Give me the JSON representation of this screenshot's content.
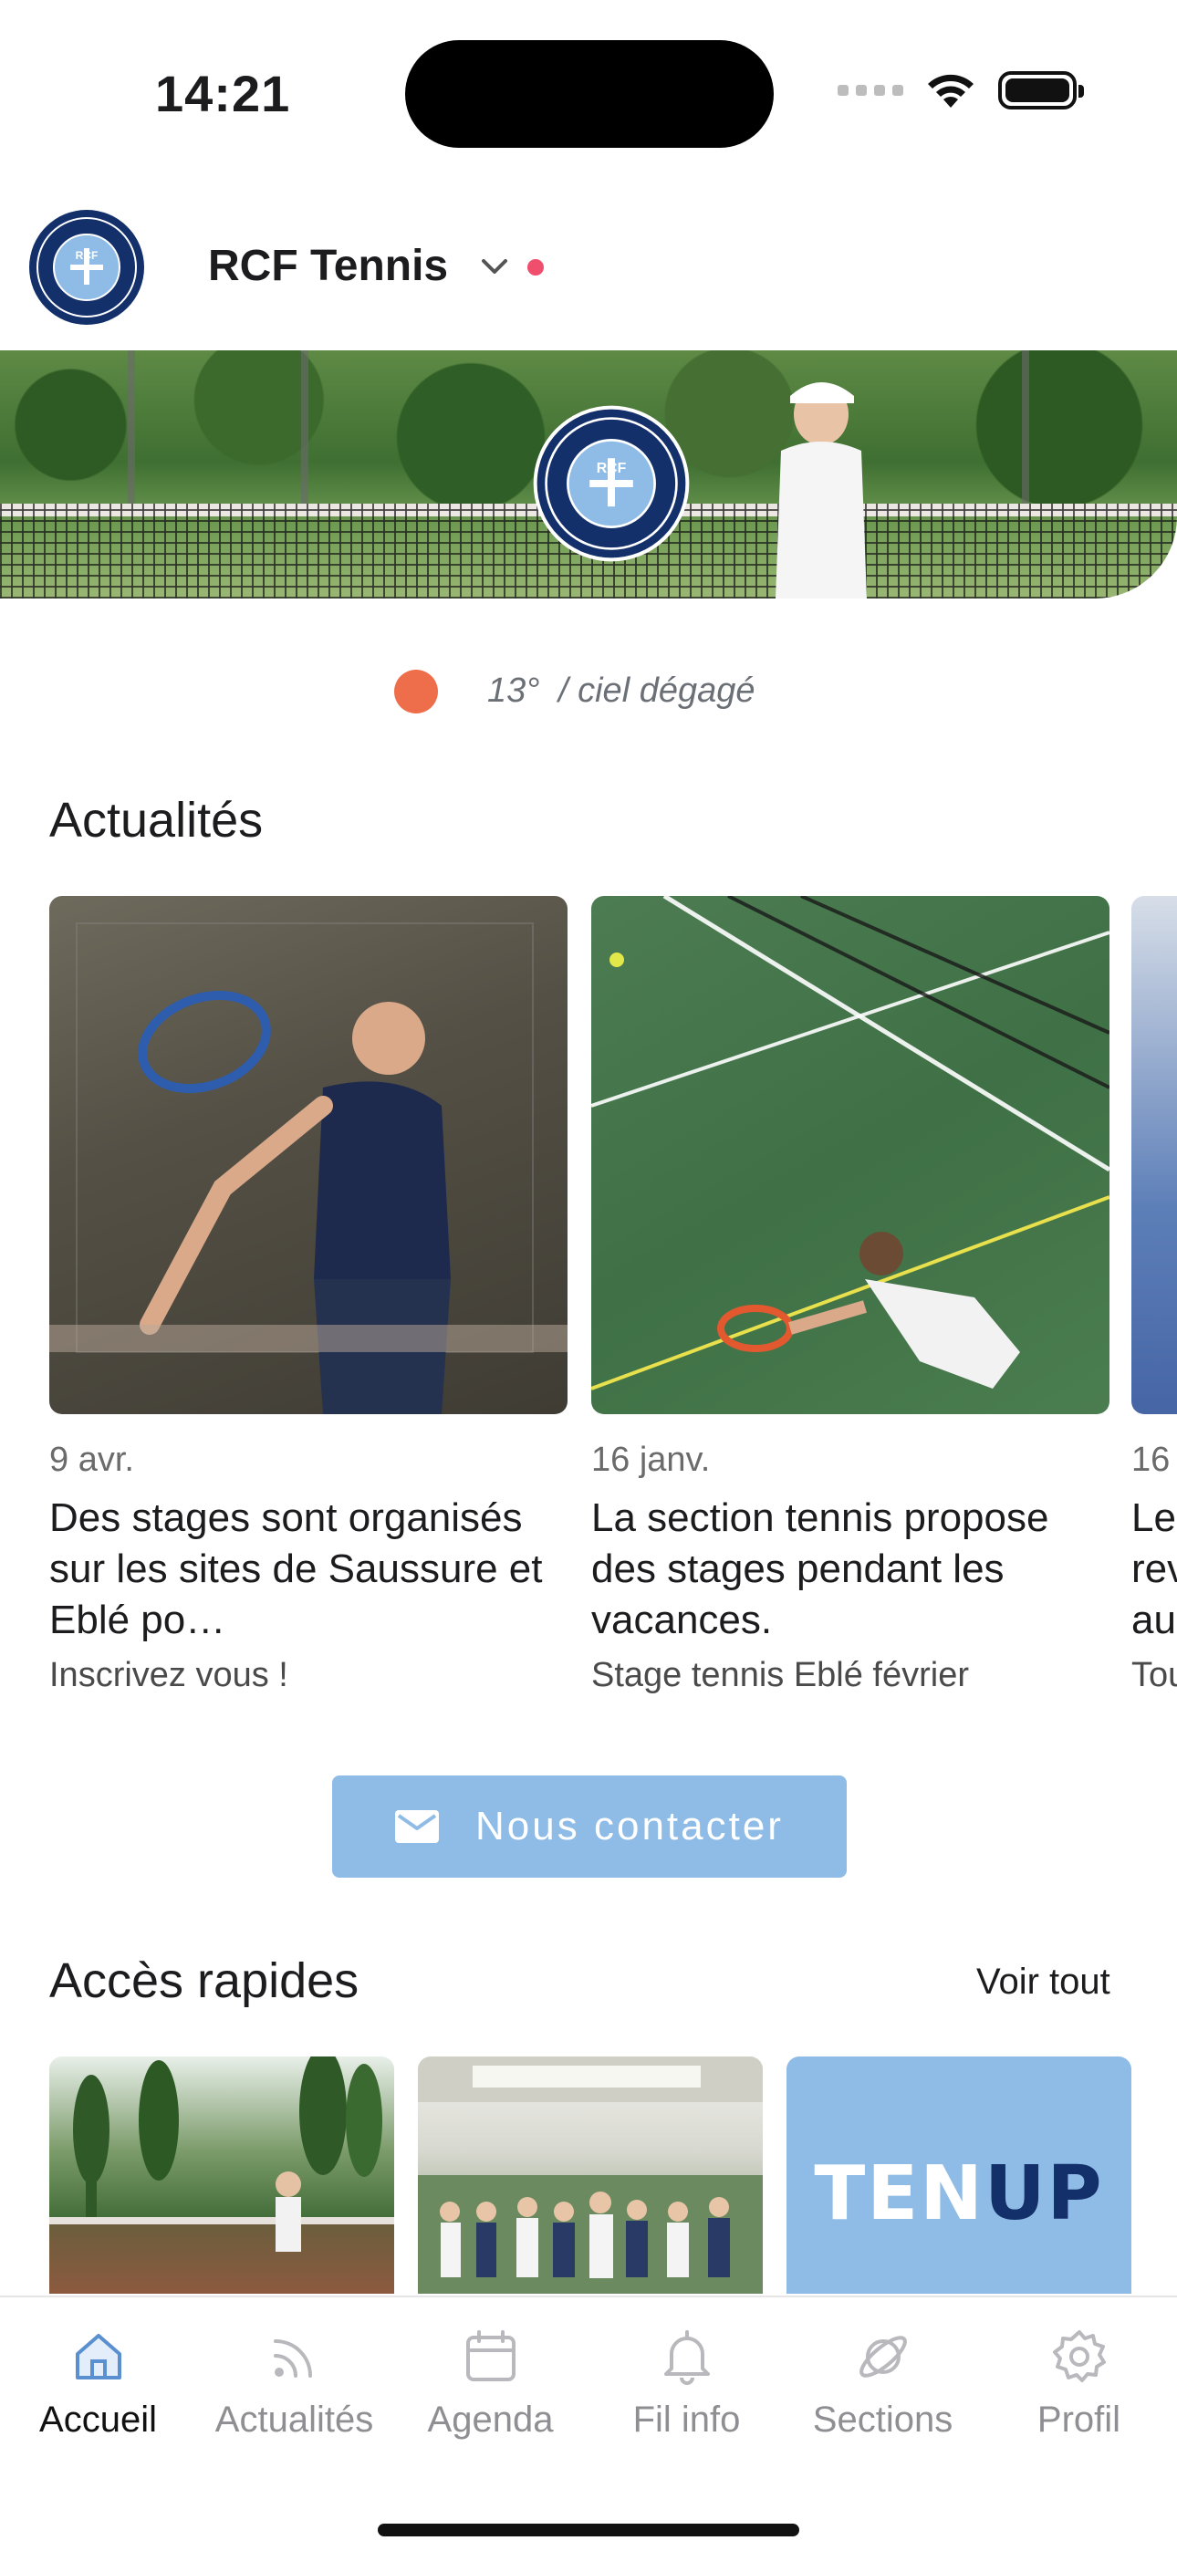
{
  "status_bar": {
    "time": "14:21"
  },
  "header": {
    "club_name": "RCF Tennis",
    "logo_text": "RCF"
  },
  "weather": {
    "temperature": "13°",
    "separator_condition": "/ ciel dégagé"
  },
  "news": {
    "title": "Actualités",
    "items": [
      {
        "date": "9 avr.",
        "title": "Des stages sont organisés sur les sites de Saussure et Eblé po…",
        "subtitle": "Inscrivez vous !"
      },
      {
        "date": "16 janv.",
        "title": "La section tennis propose des stages pendant les vacances.",
        "subtitle": "Stage tennis Eblé février"
      },
      {
        "date": "16",
        "title": "Le rev au",
        "subtitle": "Tou"
      }
    ]
  },
  "contact": {
    "label": "Nous contacter"
  },
  "quick_access": {
    "title": "Accès rapides",
    "see_all": "Voir tout",
    "tenup_part1": "TEN",
    "tenup_part2": "UP"
  },
  "tabs": [
    {
      "label": "Accueil",
      "icon": "home-icon",
      "active": true
    },
    {
      "label": "Actualités",
      "icon": "rss-icon",
      "active": false
    },
    {
      "label": "Agenda",
      "icon": "calendar-icon",
      "active": false
    },
    {
      "label": "Fil info",
      "icon": "bell-icon",
      "active": false
    },
    {
      "label": "Sections",
      "icon": "planet-icon",
      "active": false
    },
    {
      "label": "Profil",
      "icon": "gear-icon",
      "active": false
    }
  ],
  "colors": {
    "accent_blue": "#8fbce6",
    "notification_dot": "#ef4f6c",
    "weather_dot": "#ee6e4b",
    "navy": "#14306a"
  }
}
